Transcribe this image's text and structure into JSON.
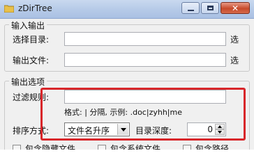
{
  "window": {
    "title": "zDirTree"
  },
  "input_group": {
    "legend": "输入输出",
    "select_dir_label": "选择目录:",
    "select_dir_value": "",
    "select_dir_trail": "选",
    "output_file_label": "输出文件:",
    "output_file_value": "",
    "output_file_trail": "选"
  },
  "options_group": {
    "legend": "输出选项",
    "filter_label": "过滤规则:",
    "filter_value": "",
    "format_hint": "格式: | 分隔, 示例: .doc|zyhh|me",
    "sort_label": "排序方式:",
    "sort_value": "文件名升序",
    "depth_label": "目录深度:",
    "depth_value": "0",
    "checkboxes": [
      {
        "label": "包含隐藏文件",
        "checked": false
      },
      {
        "label": "包含系统文件",
        "checked": false
      },
      {
        "label": "包含路径",
        "checked": false
      }
    ]
  },
  "colors": {
    "highlight": "#d8262a",
    "titlebar": "#b7cbe8"
  }
}
